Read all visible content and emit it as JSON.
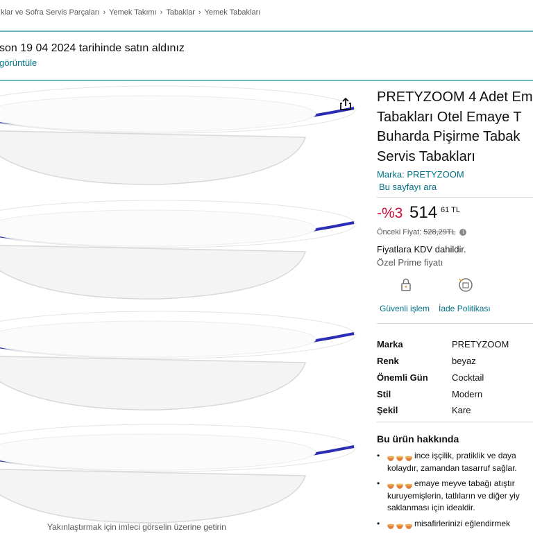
{
  "breadcrumb": {
    "items": [
      "ıklar ve Sofra Servis Parçaları",
      "Yemek Takımı",
      "Tabaklar",
      "Yemek Tabakları"
    ],
    "separator": "›"
  },
  "purchase_notice": {
    "text": "son 19 04 2024 tarihinde satın aldınız",
    "link": "görüntüle"
  },
  "gallery": {
    "zoom_hint": "Yakınlaştırmak için imleci görselin üzerine getirin",
    "share_icon": "share-icon",
    "plate_count": 4,
    "plate_rim_color": "#2c2cb4"
  },
  "product": {
    "title_lines": [
      "PRETYZOOM 4 Adet Em",
      "Tabakları Otel Emaye T",
      "Buharda Pişirme Tabak",
      "Servis Tabakları"
    ],
    "brand_label": "Marka: PRETYZOOM",
    "search_page": "Bu sayfayı ara"
  },
  "price": {
    "discount": "-%3",
    "whole": "514",
    "fraction": "61",
    "currency": "TL",
    "previous_label": "Önceki Fiyat:",
    "previous_value": "528,29TL",
    "vat_note": "Fiyatlara KDV dahildir.",
    "prime_note": "Özel Prime fiyatı"
  },
  "features": [
    {
      "label": "Güvenli işlem",
      "icon": "lock-icon"
    },
    {
      "label": "İade Politikası",
      "icon": "return-icon"
    }
  ],
  "specs": [
    {
      "key": "Marka",
      "value": "PRETYZOOM"
    },
    {
      "key": "Renk",
      "value": "beyaz"
    },
    {
      "key": "Önemli Gün",
      "value": "Cocktail"
    },
    {
      "key": "Stil",
      "value": "Modern"
    },
    {
      "key": "Şekil",
      "value": "Kare"
    }
  ],
  "about": {
    "title": "Bu ürün hakkında",
    "bullets": [
      {
        "lines": [
          "ince işçilik, pratiklik ve daya",
          "kolaydır, zamandan tasarruf sağlar."
        ]
      },
      {
        "lines": [
          "emaye meyve tabağı atıştır",
          "kuruyemişlerin, tatlıların ve diğer yiy",
          "saklanması için idealdir."
        ]
      },
      {
        "lines": [
          "misafirlerinizi eğlendirmek"
        ]
      }
    ]
  },
  "colors": {
    "link": "#007185",
    "discount": "#cc0c39",
    "teal_rule": "#6cb5c1"
  }
}
